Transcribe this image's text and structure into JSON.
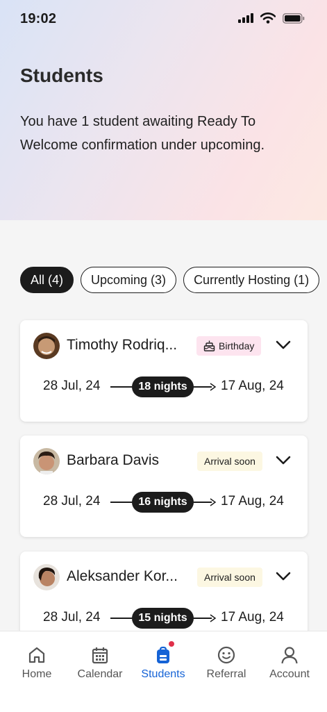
{
  "status_bar": {
    "time": "19:02",
    "icons": [
      "signal-icon",
      "wifi-icon",
      "battery-icon"
    ]
  },
  "header": {
    "title": "Students",
    "subtitle": "You have 1 student awaiting Ready To Welcome confirmation under upcoming."
  },
  "filters": [
    {
      "label": "All (4)",
      "active": true
    },
    {
      "label": "Upcoming (3)",
      "active": false
    },
    {
      "label": "Currently Hosting (1)",
      "active": false
    }
  ],
  "students": [
    {
      "name": "Timothy Rodriq...",
      "badge": "Birthday",
      "badge_icon": "cake-icon",
      "check_in": "28 Jul, 24",
      "nights": "18 nights",
      "check_out": "17 Aug, 24"
    },
    {
      "name": "Barbara Davis",
      "badge": "Arrival soon",
      "check_in": "28 Jul, 24",
      "nights": "16 nights",
      "check_out": "17 Aug, 24"
    },
    {
      "name": "Aleksander Kor...",
      "badge": "Arrival soon",
      "check_in": "28 Jul, 24",
      "nights": "15 nights",
      "check_out": "17 Aug, 24"
    }
  ],
  "tabs": [
    {
      "label": "Home",
      "icon": "home-icon"
    },
    {
      "label": "Calendar",
      "icon": "calendar-icon"
    },
    {
      "label": "Students",
      "icon": "backpack-icon",
      "active": true,
      "notification_dot": true
    },
    {
      "label": "Referral",
      "icon": "smiley-icon"
    },
    {
      "label": "Account",
      "icon": "person-icon"
    }
  ],
  "colors": {
    "accent": "#1563d6",
    "dark": "#1c1c1c",
    "notification": "#e0304a",
    "birthday_badge": "#fde4ef",
    "arrival_badge": "#fcf7e2"
  }
}
